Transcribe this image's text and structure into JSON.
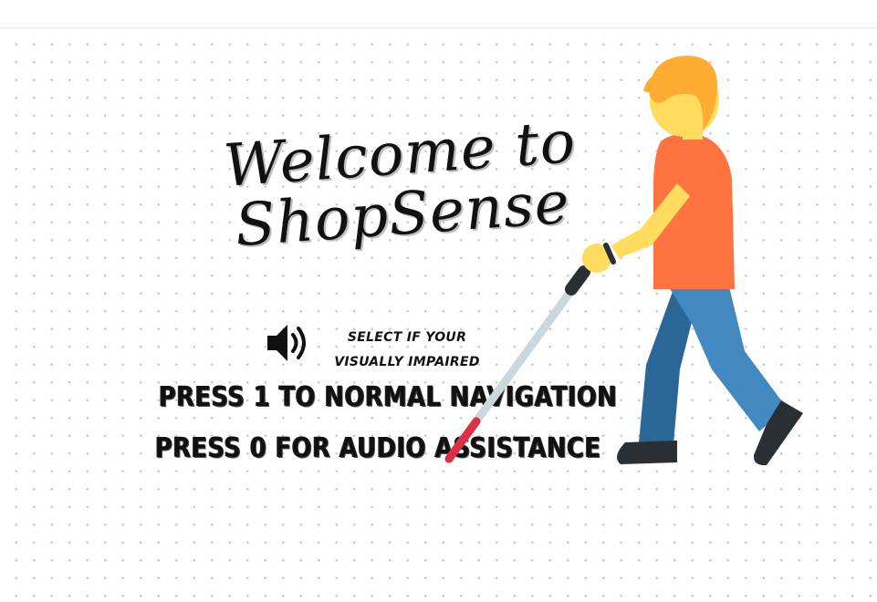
{
  "welcome": {
    "line1": "Welcome to",
    "line2": "ShopSense"
  },
  "audio_hint": {
    "line1": "SELECT IF YOUR",
    "line2": "VISUALLY IMPAIRED"
  },
  "options": {
    "normal": "PRESS 1 TO NORMAL NAVIGATION",
    "audio": "PRESS 0 FOR AUDIO ASSISTANCE"
  },
  "icons": {
    "speaker": "speaker-icon",
    "illustration": "person-with-white-cane"
  },
  "colors": {
    "hair": "#FFAC33",
    "skin": "#FFDC5D",
    "shirt": "#FF7340",
    "pants_front": "#4289C1",
    "pants_back": "#2A6797",
    "shoes": "#292F33",
    "cane": "#CCD6DD",
    "cane_tip": "#DD2E44"
  }
}
